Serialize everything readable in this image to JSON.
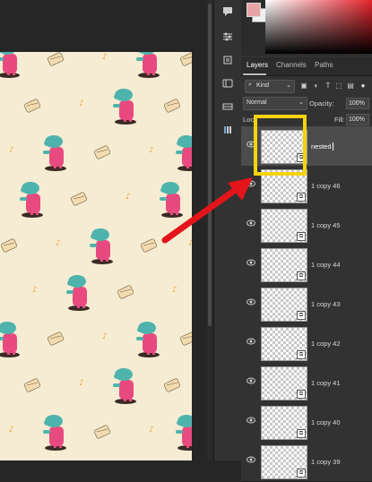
{
  "panel_tabs": [
    "Layers",
    "Channels",
    "Paths"
  ],
  "filter": {
    "kind_label": "Kind",
    "icons": [
      "image-filter-icon",
      "adjustment-filter-icon",
      "type-filter-icon",
      "shape-filter-icon",
      "smart-filter-icon"
    ]
  },
  "blend": {
    "mode": "Normal",
    "opacity_label": "Opacity:",
    "opacity_value": "100%"
  },
  "lock": {
    "label": "Loc",
    "fill_label": "Fill:",
    "fill_value": "100%"
  },
  "layers": [
    {
      "name": "nested",
      "selected": true,
      "editing": true
    },
    {
      "name": "1 copy 46"
    },
    {
      "name": "1 copy 45"
    },
    {
      "name": "1 copy 44"
    },
    {
      "name": "1 copy 43"
    },
    {
      "name": "1 copy 42"
    },
    {
      "name": "1 copy 41"
    },
    {
      "name": "1 copy 40"
    },
    {
      "name": "1 copy 39"
    }
  ],
  "colors": {
    "doc_background": "#f5ecd3",
    "highlight": "#f5d20f",
    "arrow": "#e3151a",
    "hippo_body": "#e84a7f",
    "hippo_head": "#4fb3ad"
  }
}
